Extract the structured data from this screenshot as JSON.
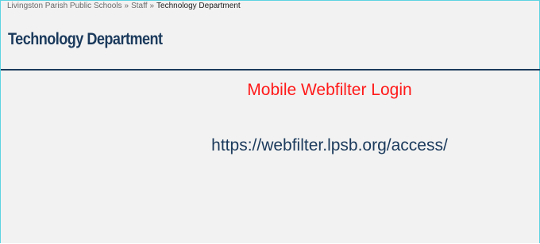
{
  "breadcrumb": {
    "items": [
      "Livingston Parish Public Schools",
      "Staff"
    ],
    "separator": "»",
    "current": "Technology Department"
  },
  "page": {
    "title": "Technology Department",
    "heading": "Mobile Webfilter Login",
    "url": "https://webfilter.lpsb.org/access/"
  },
  "colors": {
    "title": "#1b3a5c",
    "heading": "#ff1a1a",
    "url": "#1b3a5c",
    "frame_border": "#5fd3e2",
    "background": "#f2f2f2"
  }
}
